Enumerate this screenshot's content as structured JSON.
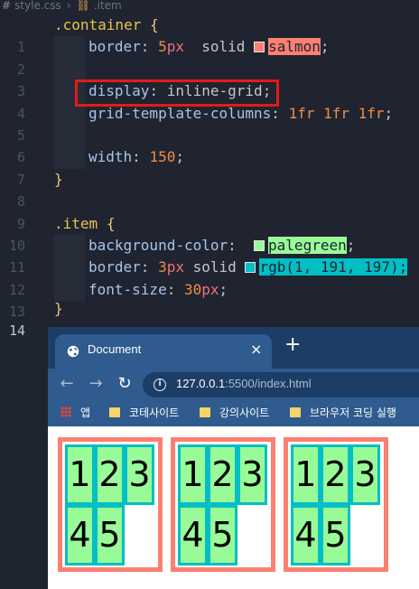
{
  "editor": {
    "breadcrumb": {
      "file": "style.css",
      "symbol": ".item"
    },
    "lines": [
      {
        "n": "1"
      },
      {
        "n": "2"
      },
      {
        "n": "3"
      },
      {
        "n": "4"
      },
      {
        "n": "5"
      },
      {
        "n": "6"
      },
      {
        "n": "7"
      },
      {
        "n": "8"
      },
      {
        "n": "9"
      },
      {
        "n": "10"
      },
      {
        "n": "11"
      },
      {
        "n": "12"
      },
      {
        "n": "13"
      },
      {
        "n": "14"
      }
    ],
    "code": {
      "container_sel": ".container",
      "open_brace": "{",
      "close_brace": "}",
      "border_prop": "border",
      "border_num": "5",
      "border_unit": "px",
      "border_style": "solid",
      "border_color": "salmon",
      "display_prop": "display",
      "display_val": "inline-grid",
      "gtc_prop": "grid-template-columns",
      "gtc_val": "1fr 1fr 1fr",
      "width_prop": "width",
      "width_num": "150",
      "item_sel": ".item",
      "bg_prop": "background-color",
      "bg_val": "palegreen",
      "item_border_prop": "border",
      "item_border_num": "3",
      "item_border_unit": "px",
      "item_border_style": "solid",
      "rgb_fn": "rgb",
      "rgb_args": "1, 191, 197",
      "fs_prop": "font-size",
      "fs_num": "30",
      "fs_unit": "px",
      "colon": ":",
      "semi": ";",
      "lparen": "(",
      "rparen": ")"
    },
    "colors": {
      "salmon": "#fa8072",
      "palegreen": "#98fb98",
      "teal": "#01bfc5"
    }
  },
  "browser": {
    "tab_title": "Document",
    "tab_close": "×",
    "new_tab": "+",
    "back": "←",
    "forward": "→",
    "reload": "↻",
    "info": "i",
    "url_host": "127.0.0.1",
    "url_rest": ":5500/index.html",
    "bookmarks": {
      "apps": "앱",
      "b1": "코테사이트",
      "b2": "강의사이트",
      "b3": "브라우저 코딩 실행"
    }
  },
  "page": {
    "containers": [
      {
        "items": [
          "1",
          "2",
          "3",
          "4",
          "5"
        ]
      },
      {
        "items": [
          "1",
          "2",
          "3",
          "4",
          "5"
        ]
      },
      {
        "items": [
          "1",
          "2",
          "3",
          "4",
          "5"
        ]
      }
    ]
  }
}
